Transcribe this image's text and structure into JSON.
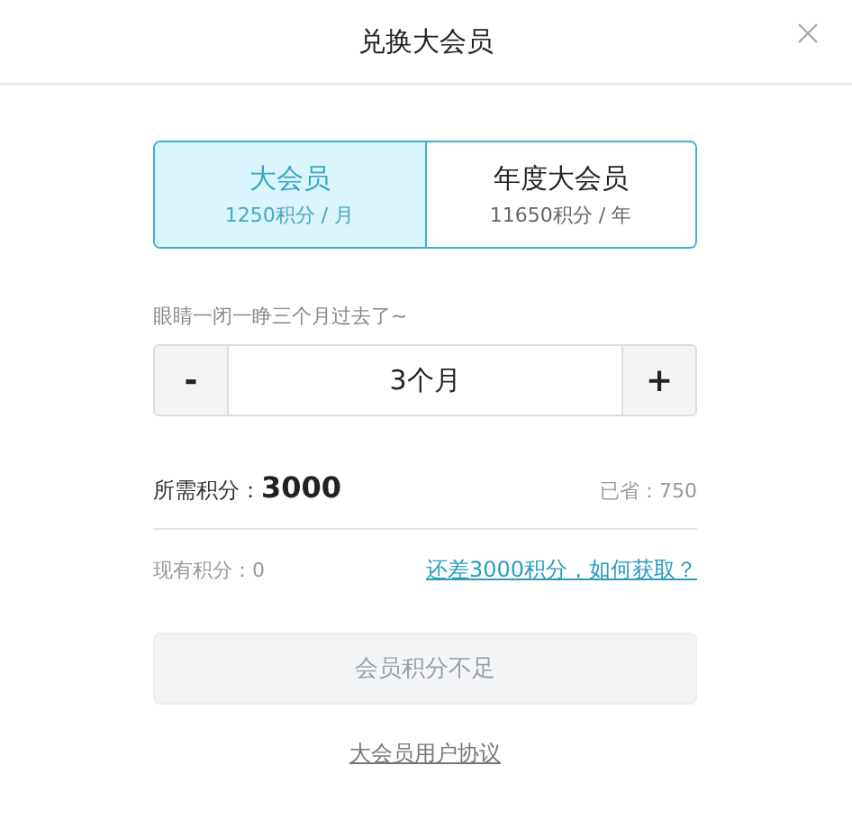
{
  "dialog": {
    "title": "兑换大会员"
  },
  "plans": [
    {
      "name": "大会员",
      "price": "1250积分 / 月",
      "selected": true
    },
    {
      "name": "年度大会员",
      "price": "11650积分 / 年",
      "selected": false
    }
  ],
  "duration": {
    "hint": "眼睛一闭一睁三个月过去了~",
    "decrement": "-",
    "value": "3个月",
    "increment": "+"
  },
  "required": {
    "label": "所需积分：",
    "value": "3000"
  },
  "saved": "已省：750",
  "current": "现有积分：0",
  "shortfall_link": "还差3000积分，如何获取？",
  "submit": {
    "label": "会员积分不足",
    "disabled": true
  },
  "agreement_link": "大会员用户协议"
}
